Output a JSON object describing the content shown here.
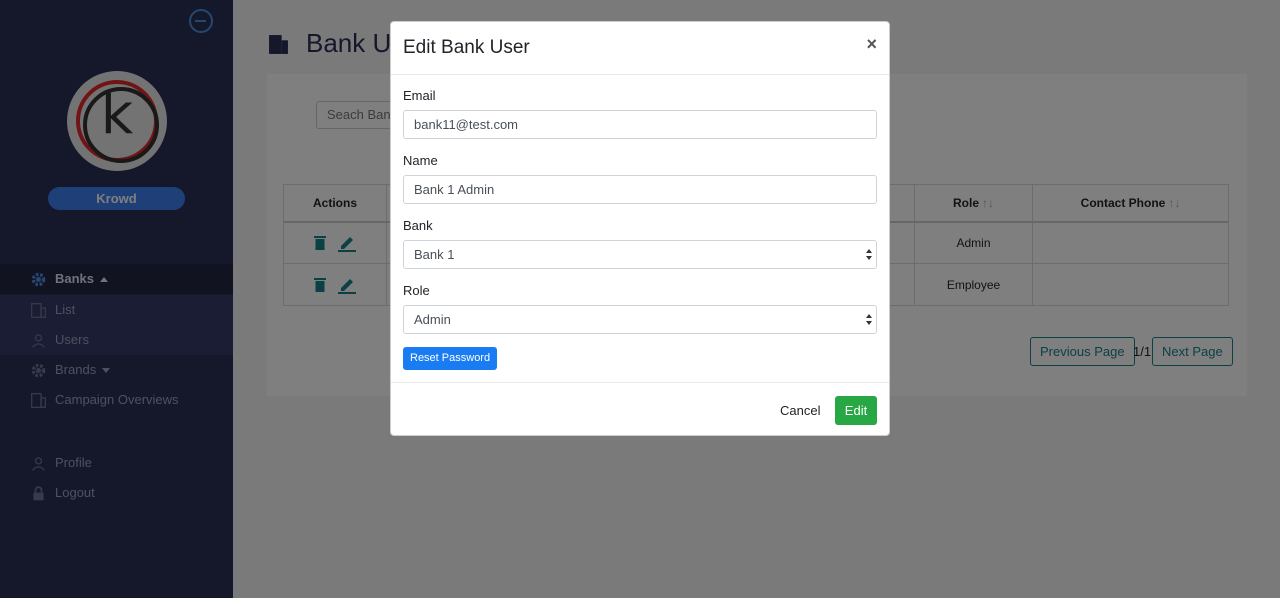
{
  "sidebar": {
    "brand_badge": "Krowd",
    "items": [
      {
        "label": "Banks"
      },
      {
        "label": "List"
      },
      {
        "label": "Users"
      },
      {
        "label": "Brands"
      },
      {
        "label": "Campaign Overviews"
      }
    ],
    "footer_items": [
      {
        "label": "Profile"
      },
      {
        "label": "Logout"
      }
    ]
  },
  "page": {
    "title": "Bank Users",
    "search_placeholder": "Seach Bank Users",
    "table": {
      "headers": [
        "Actions",
        "Role",
        "Contact Phone"
      ],
      "sort_glyph": "↑↓",
      "rows": [
        {
          "role": "Admin",
          "phone": ""
        },
        {
          "role": "Employee",
          "phone": ""
        }
      ]
    },
    "pagination": {
      "prev": "Previous Page",
      "count": "1/1",
      "next": "Next Page"
    }
  },
  "modal": {
    "title": "Edit Bank User",
    "close": "×",
    "email_label": "Email",
    "email_value": "bank11@test.com",
    "name_label": "Name",
    "name_value": "Bank 1 Admin",
    "bank_label": "Bank",
    "bank_value": "Bank 1",
    "role_label": "Role",
    "role_value": "Admin",
    "reset_label": "Reset Password",
    "cancel_label": "Cancel",
    "edit_label": "Edit"
  },
  "colors": {
    "sidebar_bg": "#2b2f55",
    "accent_teal": "#17808a",
    "primary_blue": "#1a7cf3",
    "success_green": "#28a745"
  }
}
